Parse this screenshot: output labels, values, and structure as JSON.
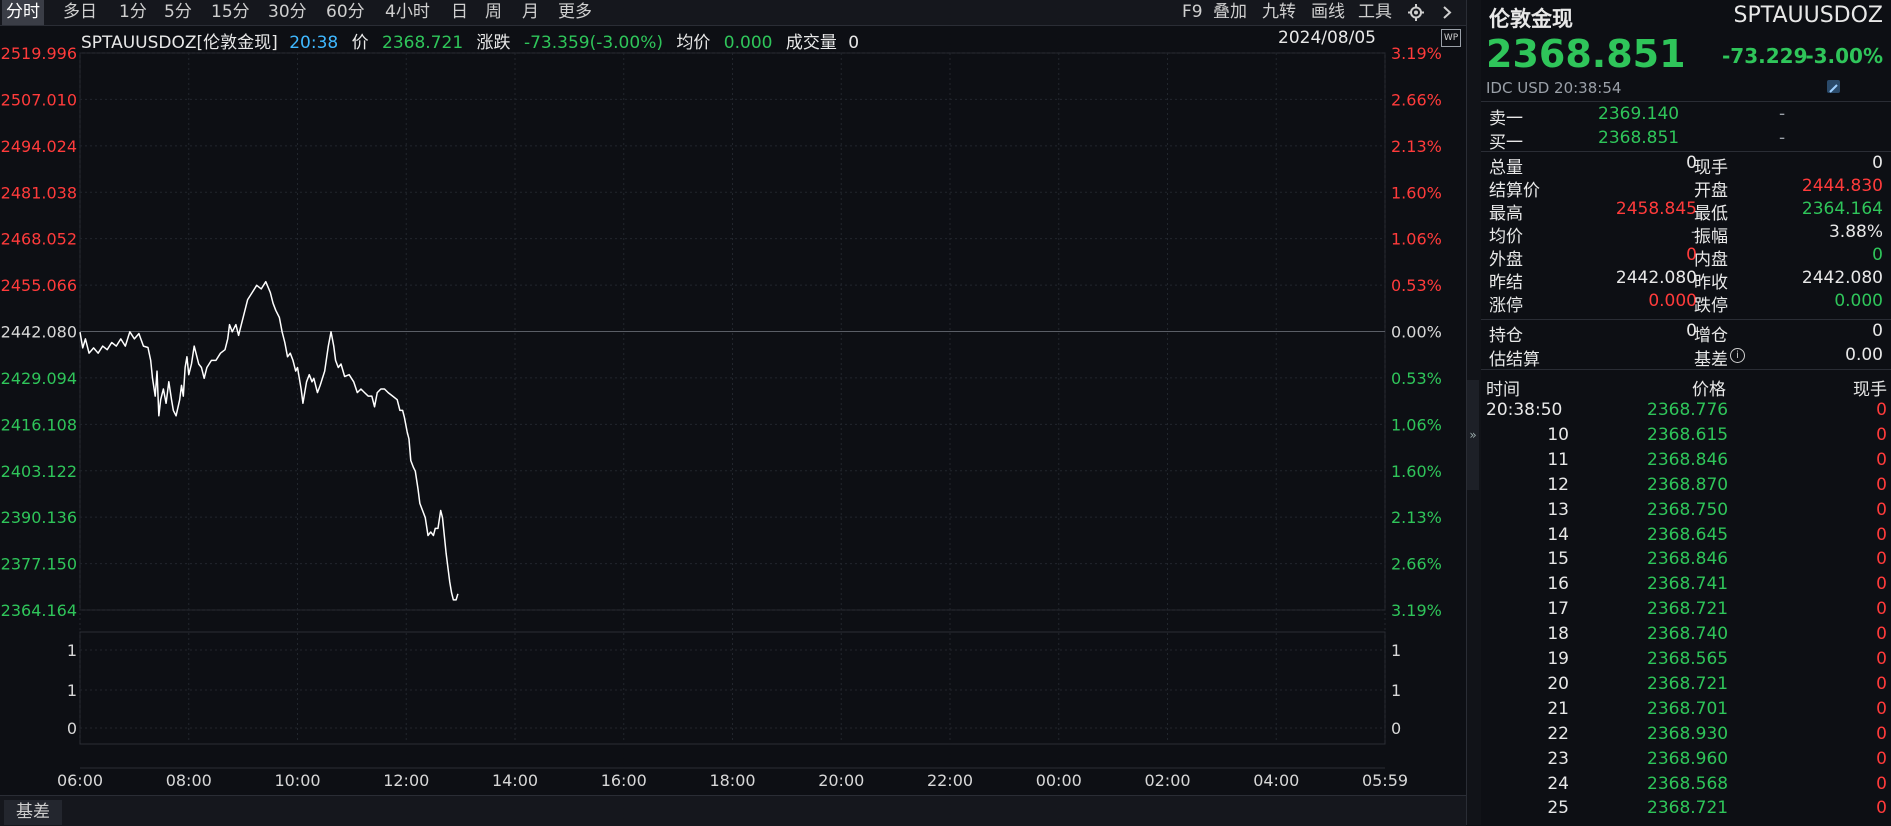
{
  "toolbar": {
    "left_items": [
      "分时",
      "多日",
      "1分",
      "5分",
      "15分",
      "30分",
      "60分",
      "4小时",
      "日",
      "周",
      "月",
      "更多"
    ],
    "right_items": [
      "F9",
      "叠加",
      "九转",
      "画线",
      "工具"
    ],
    "gear_icon": "gear-icon",
    "arrow_icon": "chevron-right-icon"
  },
  "info_bar": {
    "symbol": "SPTAUUSDOZ[伦敦金现]",
    "time": "20:38",
    "price_label": "价",
    "price": "2368.721",
    "change_label": "涨跌",
    "change": "-73.359(-3.00%)",
    "avg_label": "均价",
    "avg": "0.000",
    "volume_label": "成交量",
    "volume": "0",
    "date": "2024/08/05",
    "wp_badge": "WP"
  },
  "chart_data": {
    "type": "line",
    "y_left_ticks": [
      "2519.996",
      "2507.010",
      "2494.024",
      "2481.038",
      "2468.052",
      "2455.066",
      "2442.080",
      "2429.094",
      "2416.108",
      "2403.122",
      "2390.136",
      "2377.150",
      "2364.164"
    ],
    "y_right_ticks": [
      "3.19%",
      "2.66%",
      "2.13%",
      "1.60%",
      "1.06%",
      "0.53%",
      "0.00%",
      "0.53%",
      "1.06%",
      "1.60%",
      "2.13%",
      "2.66%",
      "3.19%"
    ],
    "volume_left_ticks": [
      "1",
      "1",
      "0"
    ],
    "volume_right_ticks": [
      "1",
      "1",
      "0"
    ],
    "x_ticks": [
      "06:00",
      "08:00",
      "10:00",
      "12:00",
      "14:00",
      "16:00",
      "18:00",
      "20:00",
      "22:00",
      "00:00",
      "02:00",
      "04:00",
      "05:59"
    ],
    "ylim": [
      2364.164,
      2519.996
    ],
    "prev_close": 2442.08,
    "series": [
      {
        "values": [
          [
            0,
            2441.9
          ],
          [
            3,
            2437.5
          ],
          [
            6,
            2440
          ],
          [
            10,
            2436
          ],
          [
            15,
            2437.5
          ],
          [
            20,
            2436
          ],
          [
            25,
            2438
          ],
          [
            30,
            2437
          ],
          [
            35,
            2439
          ],
          [
            40,
            2438
          ],
          [
            45,
            2440
          ],
          [
            50,
            2438
          ],
          [
            55,
            2442
          ],
          [
            60,
            2440
          ],
          [
            65,
            2441.5
          ],
          [
            70,
            2438
          ],
          [
            75,
            2437.6
          ],
          [
            78,
            2434
          ],
          [
            80,
            2429
          ],
          [
            83,
            2424
          ],
          [
            85,
            2431
          ],
          [
            87,
            2418.5
          ],
          [
            89,
            2423
          ],
          [
            92,
            2426
          ],
          [
            95,
            2422
          ],
          [
            98,
            2428
          ],
          [
            101,
            2423
          ],
          [
            103,
            2420
          ],
          [
            106,
            2418.5
          ],
          [
            110,
            2423
          ],
          [
            112,
            2427
          ],
          [
            114,
            2424
          ],
          [
            116,
            2432
          ],
          [
            118,
            2435
          ],
          [
            120,
            2430
          ],
          [
            123,
            2433
          ],
          [
            126,
            2438
          ],
          [
            128,
            2436
          ],
          [
            131,
            2433
          ],
          [
            134,
            2432
          ],
          [
            137,
            2429
          ],
          [
            140,
            2432
          ],
          [
            145,
            2434
          ],
          [
            150,
            2434
          ],
          [
            155,
            2436
          ],
          [
            160,
            2437
          ],
          [
            163,
            2440
          ],
          [
            165,
            2444
          ],
          [
            168,
            2442
          ],
          [
            172,
            2444
          ],
          [
            175,
            2441
          ],
          [
            178,
            2444
          ],
          [
            181,
            2447
          ],
          [
            185,
            2451
          ],
          [
            190,
            2453
          ],
          [
            195,
            2455
          ],
          [
            200,
            2454
          ],
          [
            205,
            2456
          ],
          [
            210,
            2453
          ],
          [
            213,
            2450
          ],
          [
            216,
            2448
          ],
          [
            220,
            2446
          ],
          [
            223,
            2442
          ],
          [
            226,
            2439
          ],
          [
            229,
            2435
          ],
          [
            232,
            2436
          ],
          [
            235,
            2434
          ],
          [
            238,
            2431
          ],
          [
            240,
            2432
          ],
          [
            244,
            2426
          ],
          [
            246,
            2422
          ],
          [
            250,
            2428
          ],
          [
            253,
            2430
          ],
          [
            256,
            2428
          ],
          [
            258,
            2429
          ],
          [
            262,
            2425
          ],
          [
            265,
            2427
          ],
          [
            270,
            2431
          ],
          [
            274,
            2438
          ],
          [
            277,
            2442
          ],
          [
            280,
            2438
          ],
          [
            282,
            2434
          ],
          [
            285,
            2432
          ],
          [
            288,
            2433
          ],
          [
            292,
            2429.5
          ],
          [
            297,
            2430
          ],
          [
            302,
            2428
          ],
          [
            306,
            2425
          ],
          [
            310,
            2426
          ],
          [
            314,
            2425
          ],
          [
            318,
            2424
          ],
          [
            322,
            2424
          ],
          [
            325,
            2421
          ],
          [
            328,
            2425
          ],
          [
            332,
            2426
          ],
          [
            336,
            2426
          ],
          [
            340,
            2425
          ],
          [
            345,
            2424
          ],
          [
            350,
            2423
          ],
          [
            353,
            2420
          ],
          [
            356,
            2420
          ],
          [
            358,
            2418
          ],
          [
            361,
            2414
          ],
          [
            363,
            2412
          ],
          [
            365,
            2406
          ],
          [
            368,
            2404
          ],
          [
            370,
            2403
          ],
          [
            373,
            2398
          ],
          [
            375,
            2394
          ],
          [
            378,
            2392
          ],
          [
            381,
            2390
          ],
          [
            384,
            2385
          ],
          [
            387,
            2386
          ],
          [
            390,
            2385
          ],
          [
            392,
            2387
          ],
          [
            395,
            2387
          ],
          [
            398,
            2392
          ],
          [
            400,
            2390
          ],
          [
            402,
            2385
          ],
          [
            404,
            2380
          ],
          [
            406,
            2376
          ],
          [
            408,
            2372
          ],
          [
            410,
            2369
          ],
          [
            412,
            2367
          ],
          [
            415,
            2367
          ],
          [
            417,
            2368.7
          ]
        ]
      }
    ],
    "minutes_total": 1440,
    "minutes_per_tick": 120
  },
  "panel": {
    "title": "伦敦金现",
    "code": "SPTAUUSDOZ",
    "price": "2368.851",
    "change": "-73.229",
    "change_pct": "-3.00%",
    "sub": "IDC  USD  20:38:54",
    "edit_icon": "pencil-icon",
    "ask_label": "卖一",
    "ask_price": "2369.140",
    "ask_vol": "-",
    "bid_label": "买一",
    "bid_price": "2368.851",
    "bid_vol": "-",
    "stats": [
      {
        "l1": "总量",
        "v1": "0",
        "c1": "white",
        "l2": "现手",
        "v2": "0",
        "c2": "white"
      },
      {
        "l1": "结算价",
        "v1": "",
        "c1": "white",
        "l2": "开盘",
        "v2": "2444.830",
        "c2": "red"
      },
      {
        "l1": "最高",
        "v1": "2458.845",
        "c1": "red",
        "l2": "最低",
        "v2": "2364.164",
        "c2": "green"
      },
      {
        "l1": "均价",
        "v1": "-",
        "c1": "gray",
        "l2": "振幅",
        "v2": "3.88%",
        "c2": "white"
      },
      {
        "l1": "外盘",
        "v1": "0",
        "c1": "red",
        "l2": "内盘",
        "v2": "0",
        "c2": "green"
      },
      {
        "l1": "昨结",
        "v1": "2442.080",
        "c1": "white",
        "l2": "昨收",
        "v2": "2442.080",
        "c2": "white"
      },
      {
        "l1": "涨停",
        "v1": "0.000",
        "c1": "red",
        "l2": "跌停",
        "v2": "0.000",
        "c2": "green"
      }
    ],
    "hold_label": "持仓",
    "hold_val": "0",
    "add_label": "增仓",
    "add_val": "0",
    "est_label": "估结算",
    "basis_label": "基差",
    "basis_val": "0.00",
    "info_icon": "info-icon",
    "ticks_header": [
      "时间",
      "价格",
      "现手"
    ],
    "ticks": [
      {
        "t": "20:38:50",
        "p": "2368.776",
        "v": "0"
      },
      {
        "t": "10",
        "p": "2368.615",
        "v": "0"
      },
      {
        "t": "11",
        "p": "2368.846",
        "v": "0"
      },
      {
        "t": "12",
        "p": "2368.870",
        "v": "0"
      },
      {
        "t": "13",
        "p": "2368.750",
        "v": "0"
      },
      {
        "t": "14",
        "p": "2368.645",
        "v": "0"
      },
      {
        "t": "15",
        "p": "2368.846",
        "v": "0"
      },
      {
        "t": "16",
        "p": "2368.741",
        "v": "0"
      },
      {
        "t": "17",
        "p": "2368.721",
        "v": "0"
      },
      {
        "t": "18",
        "p": "2368.740",
        "v": "0"
      },
      {
        "t": "19",
        "p": "2368.565",
        "v": "0"
      },
      {
        "t": "20",
        "p": "2368.721",
        "v": "0"
      },
      {
        "t": "21",
        "p": "2368.701",
        "v": "0"
      },
      {
        "t": "22",
        "p": "2368.930",
        "v": "0"
      },
      {
        "t": "23",
        "p": "2368.960",
        "v": "0"
      },
      {
        "t": "24",
        "p": "2368.568",
        "v": "0"
      },
      {
        "t": "25",
        "p": "2368.721",
        "v": "0"
      }
    ]
  },
  "footer": {
    "tab": "基差"
  },
  "colors": {
    "up": "#ff3b3b",
    "down": "#2fc55a",
    "line": "#ffffff",
    "grid": "#262a32",
    "bg": "#0d0f14"
  }
}
